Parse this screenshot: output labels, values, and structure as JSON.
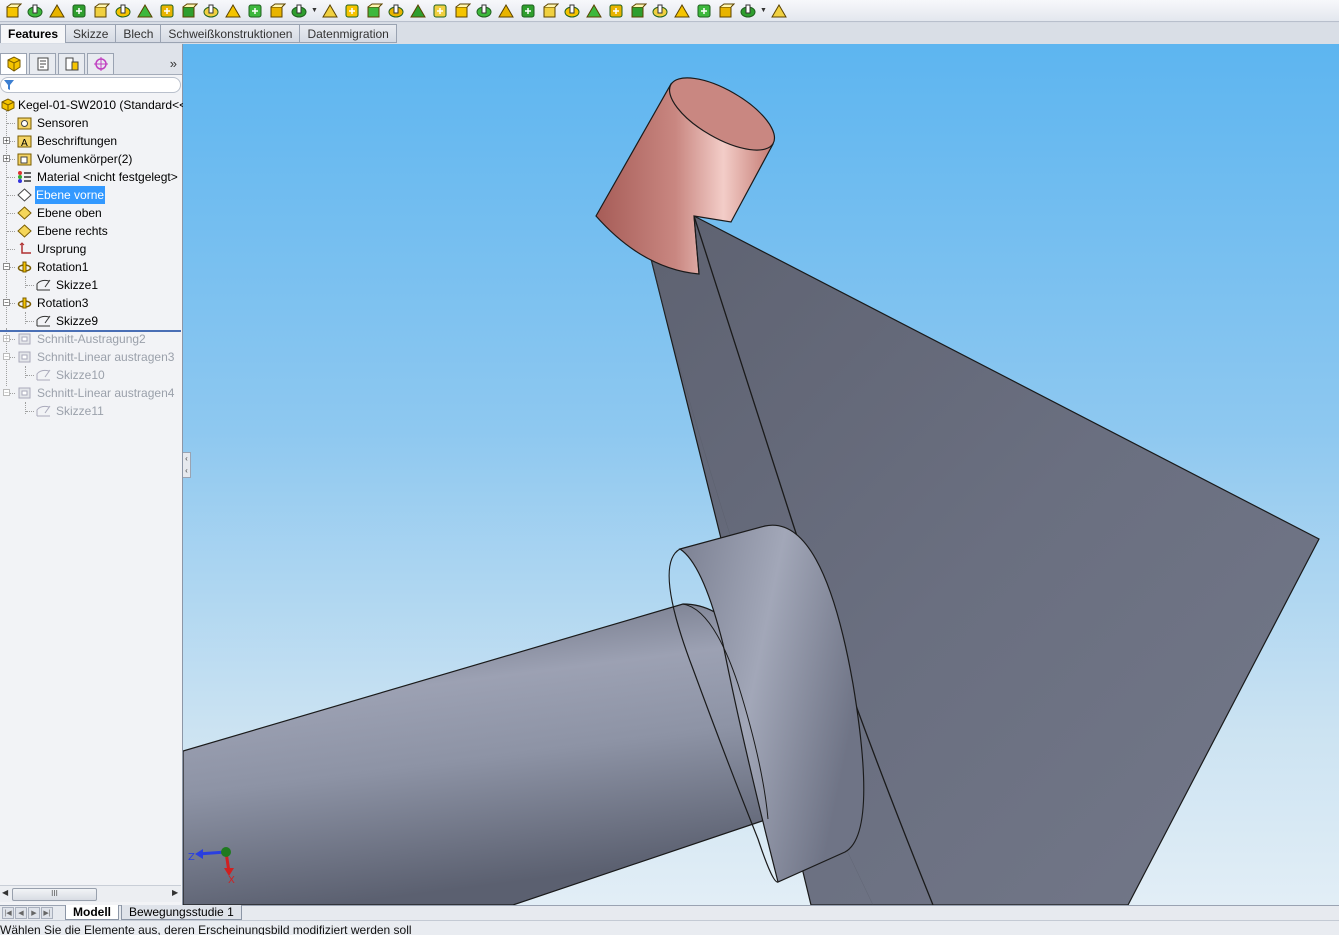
{
  "toolbar": {
    "icons": [
      "extruded-boss-icon",
      "revolved-boss-icon",
      "swept-boss-icon",
      "lofted-boss-icon",
      "boundary-boss-icon",
      "extruded-cut-icon",
      "hole-wizard-icon",
      "revolved-cut-icon",
      "swept-cut-icon",
      "lofted-cut-icon",
      "boundary-cut-icon",
      "fillet-icon",
      "chamfer-icon",
      "linear-pattern-icon",
      "rib-icon",
      "draft-icon",
      "shell-icon",
      "wrap-icon",
      "dome-icon",
      "intersect-icon",
      "curve-icon",
      "freeform-icon",
      "deform-icon",
      "indent-icon",
      "flex-icon",
      "combine-icon",
      "split-icon",
      "delete-body-icon",
      "move-copy-body-icon",
      "reference-geometry-icon",
      "rebuild-icon",
      "instant3d-icon",
      "reference-plane-icon",
      "appearance-icon",
      "section-view-icon"
    ]
  },
  "command_manager": {
    "tabs": [
      "Features",
      "Skizze",
      "Blech",
      "Schweißkonstruktionen",
      "Datenmigration"
    ],
    "active": "Features"
  },
  "panel": {
    "more_label": "»"
  },
  "tree": {
    "root": "Kegel-01-SW2010  (Standard<<",
    "items": [
      {
        "label": "Sensoren",
        "icon": "sensor-folder-icon"
      },
      {
        "label": "Beschriftungen",
        "icon": "annotations-icon"
      },
      {
        "label": "Volumenkörper(2)",
        "icon": "solid-bodies-icon"
      },
      {
        "label": "Material <nicht festgelegt>",
        "icon": "material-icon"
      },
      {
        "label": "Ebene vorne",
        "icon": "plane-icon"
      },
      {
        "label": "Ebene oben",
        "icon": "plane-icon"
      },
      {
        "label": "Ebene rechts",
        "icon": "plane-icon"
      },
      {
        "label": "Ursprung",
        "icon": "origin-icon"
      },
      {
        "label": "Rotation1",
        "icon": "revolve-feature-icon"
      },
      {
        "label": "Skizze1",
        "icon": "sketch-icon"
      },
      {
        "label": "Rotation3",
        "icon": "revolve-feature-icon"
      },
      {
        "label": "Skizze9",
        "icon": "sketch-icon"
      },
      {
        "label": "Schnitt-Austragung2",
        "icon": "cut-extrude-icon"
      },
      {
        "label": "Schnitt-Linear austragen3",
        "icon": "cut-extrude-icon"
      },
      {
        "label": "Skizze10",
        "icon": "sketch-icon"
      },
      {
        "label": "Schnitt-Linear austragen4",
        "icon": "cut-extrude-icon"
      },
      {
        "label": "Skizze11",
        "icon": "sketch-icon"
      }
    ],
    "selected": "Ebene vorne"
  },
  "scrollbar": {
    "thumb_label": "III"
  },
  "triad": {
    "z_label": "Z",
    "x_label": "X"
  },
  "bottom_tabs": {
    "model": "Modell",
    "motion": "Bewegungsstudie 1"
  },
  "status": {
    "text": "Wählen Sie die Elemente aus, deren Erscheinungsbild modifiziert werden soll"
  },
  "colors": {
    "viewport_top": "#5db5f0",
    "part_grey": "#6a6f80",
    "copper": "#c47a72",
    "selection": "#3399ff"
  }
}
